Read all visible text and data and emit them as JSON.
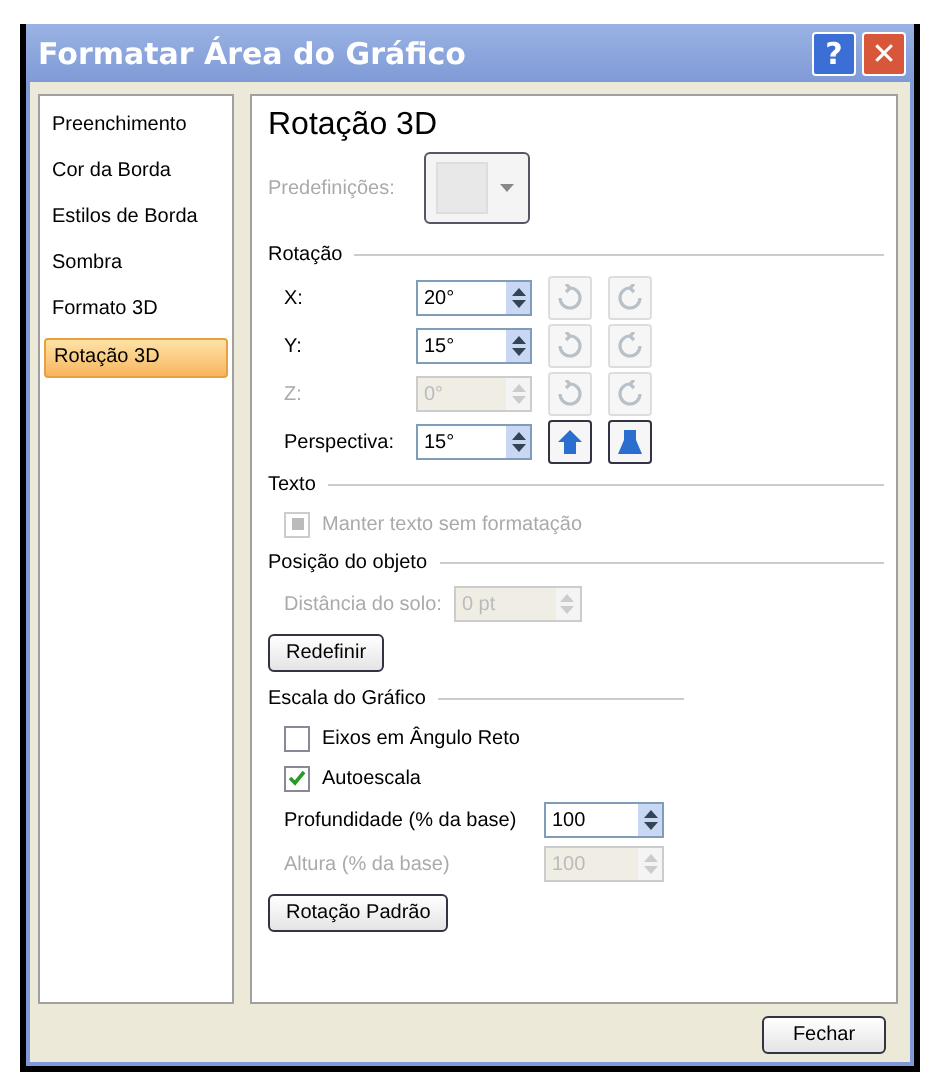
{
  "window": {
    "title": "Formatar Área do Gráfico",
    "help": "?",
    "close": "✕"
  },
  "sidebar": {
    "items": [
      {
        "label": "Preenchimento",
        "selected": false
      },
      {
        "label": "Cor da Borda",
        "selected": false
      },
      {
        "label": "Estilos de Borda",
        "selected": false
      },
      {
        "label": "Sombra",
        "selected": false
      },
      {
        "label": "Formato 3D",
        "selected": false
      },
      {
        "label": "Rotação 3D",
        "selected": true
      }
    ]
  },
  "panel": {
    "title": "Rotação 3D",
    "presets": {
      "label": "Predefinições:",
      "disabled": true
    },
    "rotation": {
      "heading": "Rotação",
      "rows": [
        {
          "label": "X:",
          "value": "20°",
          "disabled": false,
          "kind": "rotation"
        },
        {
          "label": "Y:",
          "value": "15°",
          "disabled": false,
          "kind": "rotation"
        },
        {
          "label": "Z:",
          "value": "0°",
          "disabled": true,
          "kind": "rotation"
        },
        {
          "label": "Perspectiva:",
          "value": "15°",
          "disabled": false,
          "kind": "perspective"
        }
      ]
    },
    "text": {
      "heading": "Texto",
      "checkbox": {
        "label": "Manter texto sem formatação",
        "checked": true,
        "disabled": true
      }
    },
    "position": {
      "heading": "Posição do objeto",
      "field": {
        "label": "Distância do solo:",
        "value": "0 pt",
        "disabled": true
      },
      "button": "Redefinir"
    },
    "scale": {
      "heading": "Escala do Gráfico",
      "checkboxes": [
        {
          "label": "Eixos em Ângulo Reto",
          "checked": false
        },
        {
          "label": "Autoescala",
          "checked": true
        }
      ],
      "fields": [
        {
          "label": "Profundidade (% da base)",
          "value": "100",
          "disabled": false
        },
        {
          "label": "Altura (% da base)",
          "value": "100",
          "disabled": true
        }
      ],
      "button": "Rotação Padrão"
    }
  },
  "footer": {
    "button": "Fechar"
  }
}
